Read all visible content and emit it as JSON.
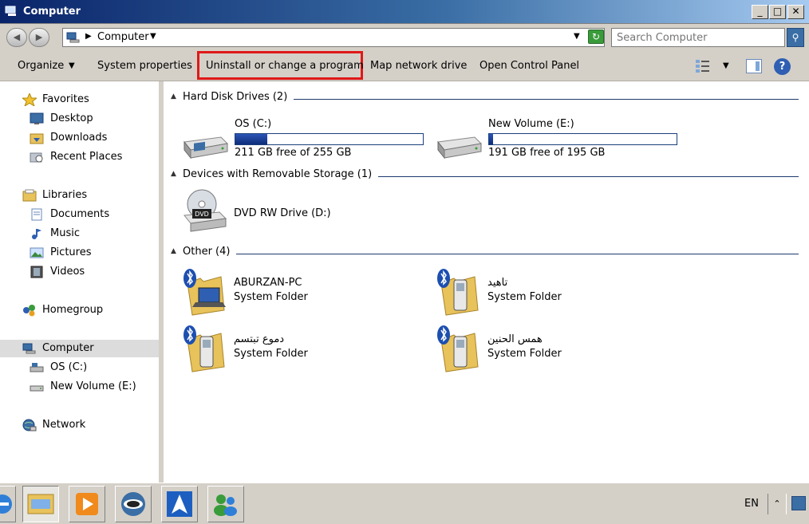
{
  "window": {
    "title": "Computer"
  },
  "address": {
    "crumb": "Computer"
  },
  "search": {
    "placeholder": "Search Computer"
  },
  "commands": {
    "organize": "Organize",
    "system_properties": "System properties",
    "uninstall": "Uninstall or change a program",
    "map_drive": "Map network drive",
    "control_panel": "Open Control Panel"
  },
  "nav": {
    "favorites": "Favorites",
    "desktop": "Desktop",
    "downloads": "Downloads",
    "recent": "Recent Places",
    "libraries": "Libraries",
    "documents": "Documents",
    "music": "Music",
    "pictures": "Pictures",
    "videos": "Videos",
    "homegroup": "Homegroup",
    "computer": "Computer",
    "os_drive": "OS (C:)",
    "new_volume": "New Volume (E:)",
    "network": "Network"
  },
  "groups": {
    "hdd": "Hard Disk Drives (2)",
    "removable": "Devices with Removable Storage (1)",
    "other": "Other (4)"
  },
  "drives": [
    {
      "name": "OS (C:)",
      "free": "211 GB free of 255 GB",
      "used_fraction": 0.17
    },
    {
      "name": "New Volume (E:)",
      "free": "191 GB free of 195 GB",
      "used_fraction": 0.02
    }
  ],
  "dvd": {
    "name": "DVD RW Drive (D:)",
    "label": "DVD"
  },
  "others": [
    {
      "name": "ABURZAN-PC",
      "type": "System Folder"
    },
    {
      "name": "تاهيد",
      "type": "System Folder"
    },
    {
      "name": "دموع تبتسم",
      "type": "System Folder"
    },
    {
      "name": "همس الحنين",
      "type": "System Folder"
    }
  ],
  "taskbar": {
    "lang": "EN"
  }
}
